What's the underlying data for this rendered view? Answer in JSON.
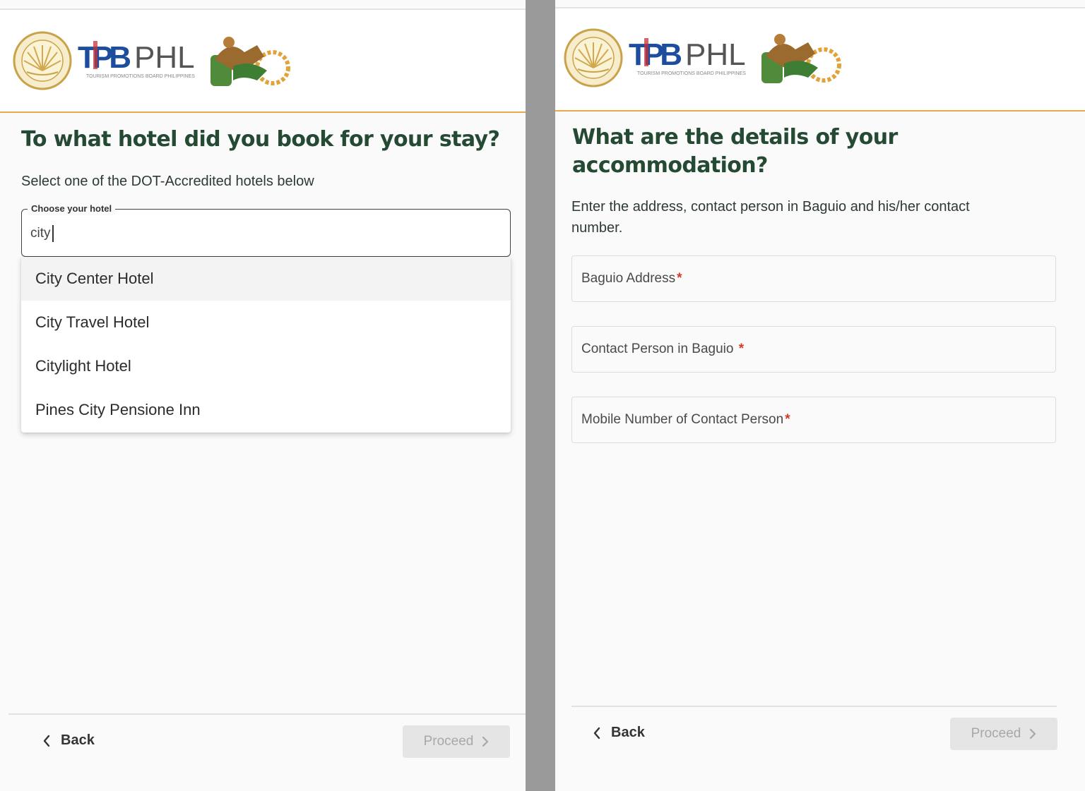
{
  "brand": {
    "seal_ring_text": "DEPARTMENT OF TOURISM PHILIPPINES",
    "tpb_mark": "TPB",
    "phl_mark": "PHL",
    "tpb_tagline": "TOURISM PROMOTIONS BOARD PHILIPPINES",
    "colors": {
      "accent_line": "#e6a94b",
      "heading": "#254a34",
      "required": "#d43a2c"
    }
  },
  "left": {
    "title": "To what hotel did you book for your stay?",
    "subtitle": "Select one of the DOT-Accredited hotels below",
    "hotel_field": {
      "legend": "Choose your hotel",
      "value": "city"
    },
    "options": [
      "City Center Hotel",
      "City Travel Hotel",
      "Citylight Hotel",
      "Pines City Pensione Inn"
    ],
    "back_label": "Back",
    "proceed_label": "Proceed"
  },
  "right": {
    "title_line1": "What are the details of your",
    "title_line2": "accommodation?",
    "subtitle_line1": "Enter the address, contact person in Baguio and his/her contact",
    "subtitle_line2": "number.",
    "fields": [
      {
        "label": "Baguio Address",
        "required_mark": "*"
      },
      {
        "label": "Contact Person in Baguio ",
        "required_mark": "*"
      },
      {
        "label": "Mobile Number of Contact Person",
        "required_mark": "*"
      }
    ],
    "back_label": "Back",
    "proceed_label": "Proceed"
  },
  "icons": {
    "back": "chevron-left-icon",
    "proceed": "chevron-right-icon"
  }
}
